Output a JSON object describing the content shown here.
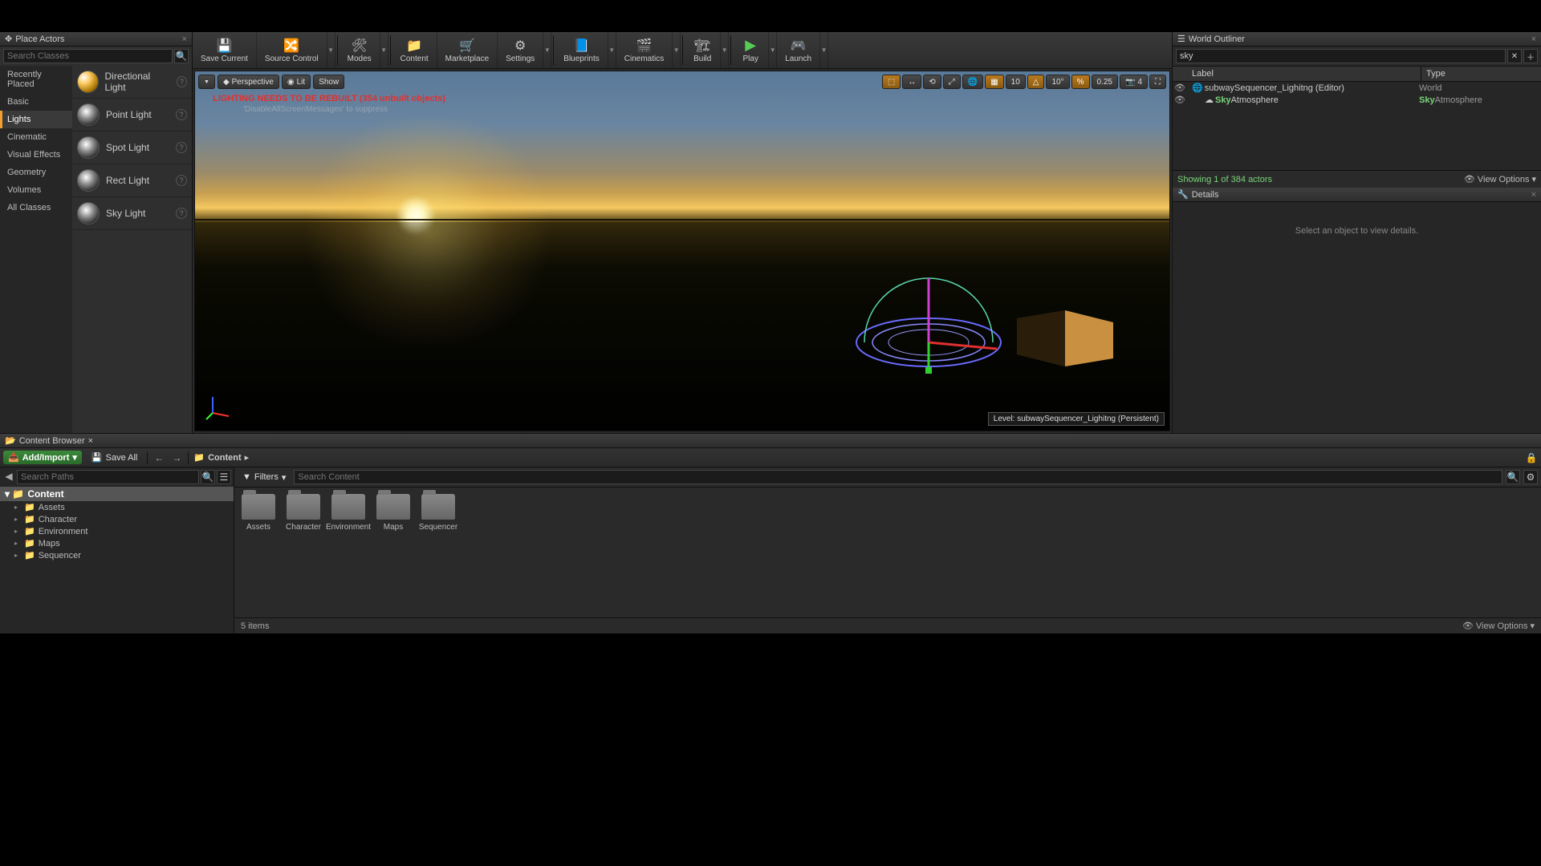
{
  "placeActors": {
    "title": "Place Actors",
    "searchPlaceholder": "Search Classes",
    "categories": [
      "Recently Placed",
      "Basic",
      "Lights",
      "Cinematic",
      "Visual Effects",
      "Geometry",
      "Volumes",
      "All Classes"
    ],
    "activeCategory": "Lights",
    "items": [
      {
        "label": "Directional Light"
      },
      {
        "label": "Point Light"
      },
      {
        "label": "Spot Light"
      },
      {
        "label": "Rect Light"
      },
      {
        "label": "Sky Light"
      }
    ]
  },
  "toolbar": {
    "save": "Save Current",
    "sourceControl": "Source Control",
    "modes": "Modes",
    "content": "Content",
    "marketplace": "Marketplace",
    "settings": "Settings",
    "blueprints": "Blueprints",
    "cinematics": "Cinematics",
    "build": "Build",
    "play": "Play",
    "launch": "Launch"
  },
  "viewport": {
    "perspective": "Perspective",
    "lit": "Lit",
    "show": "Show",
    "warning": "LIGHTING NEEDS TO BE REBUILT (354 unbuilt objects)",
    "suppress": "'DisableAllScreenMessages' to suppress",
    "snapPos": "10",
    "snapRot": "10°",
    "snapScale": "0.25",
    "camSpeed": "4",
    "levelLabel": "Level:  subwaySequencer_Lighitng (Persistent)"
  },
  "worldOutliner": {
    "title": "World Outliner",
    "search": "sky",
    "colLabel": "Label",
    "colType": "Type",
    "rows": [
      {
        "indent": 0,
        "hl": "",
        "label": "subwaySequencer_Lighitng (Editor)",
        "type": "World"
      },
      {
        "indent": 1,
        "hl": "Sky",
        "label": "Atmosphere",
        "type": "SkyAtmosphere",
        "typeHl": "Sky",
        "typeRest": "Atmosphere"
      }
    ],
    "showing": "Showing 1 of 384 actors",
    "viewOptions": "View Options"
  },
  "details": {
    "title": "Details",
    "empty": "Select an object to view details."
  },
  "contentBrowser": {
    "title": "Content Browser",
    "addImport": "Add/Import",
    "saveAll": "Save All",
    "pathRoot": "Content",
    "searchPaths": "Search Paths",
    "filters": "Filters",
    "searchContent": "Search Content",
    "treeRoot": "Content",
    "treeItems": [
      "Assets",
      "Character",
      "Environment",
      "Maps",
      "Sequencer"
    ],
    "folders": [
      "Assets",
      "Character",
      "Environment",
      "Maps",
      "Sequencer"
    ],
    "itemCount": "5 items",
    "viewOptions": "View Options"
  }
}
